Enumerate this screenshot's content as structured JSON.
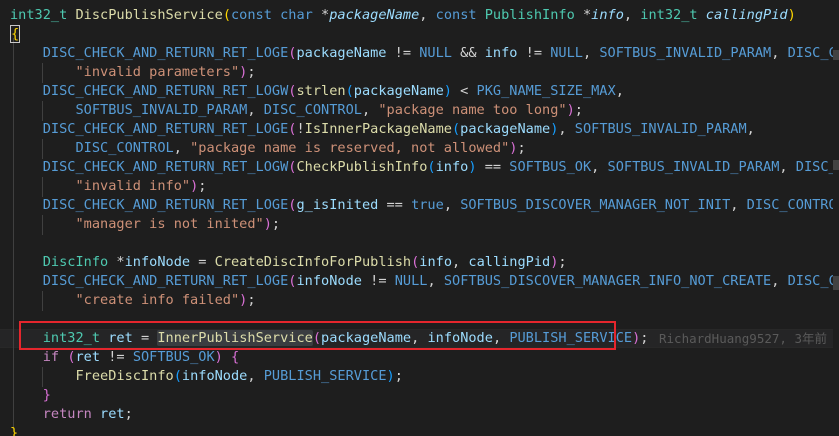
{
  "editor": {
    "blame": "RichardHuang9527, 3年前",
    "lines": [
      [
        [
          "int32_t",
          "type"
        ],
        [
          " ",
          "plain"
        ],
        [
          "DiscPublishService",
          "fn"
        ],
        [
          "(",
          "brace1"
        ],
        [
          "const",
          "kw"
        ],
        [
          " ",
          "plain"
        ],
        [
          "char",
          "kw"
        ],
        [
          " *",
          "plain"
        ],
        [
          "packageName",
          "param"
        ],
        [
          ", ",
          "plain"
        ],
        [
          "const",
          "kw"
        ],
        [
          " ",
          "plain"
        ],
        [
          "PublishInfo",
          "type"
        ],
        [
          " *",
          "plain"
        ],
        [
          "info",
          "param"
        ],
        [
          ", ",
          "plain"
        ],
        [
          "int32_t",
          "type"
        ],
        [
          " ",
          "plain"
        ],
        [
          "callingPid",
          "param"
        ],
        [
          ")",
          "brace1"
        ]
      ],
      [
        [
          "{",
          "brace1"
        ]
      ],
      [
        [
          "    ",
          "plain"
        ],
        [
          "DISC_CHECK_AND_RETURN_RET_LOGE",
          "macro"
        ],
        [
          "(",
          "brace2"
        ],
        [
          "packageName",
          "var"
        ],
        [
          " != ",
          "plain"
        ],
        [
          "NULL",
          "macro"
        ],
        [
          " && ",
          "plain"
        ],
        [
          "info",
          "var"
        ],
        [
          " != ",
          "plain"
        ],
        [
          "NULL",
          "macro"
        ],
        [
          ", ",
          "plain"
        ],
        [
          "SOFTBUS_INVALID_PARAM",
          "macro"
        ],
        [
          ", ",
          "plain"
        ],
        [
          "DISC_CONTROL",
          "macro"
        ],
        [
          ",",
          "plain"
        ]
      ],
      [
        [
          "        ",
          "plain"
        ],
        [
          "\"invalid parameters\"",
          "str"
        ],
        [
          ")",
          "brace2"
        ],
        [
          ";",
          "plain"
        ]
      ],
      [
        [
          "    ",
          "plain"
        ],
        [
          "DISC_CHECK_AND_RETURN_RET_LOGW",
          "macro"
        ],
        [
          "(",
          "brace2"
        ],
        [
          "strlen",
          "fn"
        ],
        [
          "(",
          "brace3"
        ],
        [
          "packageName",
          "var"
        ],
        [
          ")",
          "brace3"
        ],
        [
          " < ",
          "plain"
        ],
        [
          "PKG_NAME_SIZE_MAX",
          "macro"
        ],
        [
          ",",
          "plain"
        ]
      ],
      [
        [
          "        ",
          "plain"
        ],
        [
          "SOFTBUS_INVALID_PARAM",
          "macro"
        ],
        [
          ", ",
          "plain"
        ],
        [
          "DISC_CONTROL",
          "macro"
        ],
        [
          ", ",
          "plain"
        ],
        [
          "\"package name too long\"",
          "str"
        ],
        [
          ")",
          "brace2"
        ],
        [
          ";",
          "plain"
        ]
      ],
      [
        [
          "    ",
          "plain"
        ],
        [
          "DISC_CHECK_AND_RETURN_RET_LOGE",
          "macro"
        ],
        [
          "(",
          "brace2"
        ],
        [
          "!",
          "plain"
        ],
        [
          "IsInnerPackageName",
          "fn"
        ],
        [
          "(",
          "brace3"
        ],
        [
          "packageName",
          "var"
        ],
        [
          ")",
          "brace3"
        ],
        [
          ", ",
          "plain"
        ],
        [
          "SOFTBUS_INVALID_PARAM",
          "macro"
        ],
        [
          ",",
          "plain"
        ]
      ],
      [
        [
          "        ",
          "plain"
        ],
        [
          "DISC_CONTROL",
          "macro"
        ],
        [
          ", ",
          "plain"
        ],
        [
          "\"package name is reserved, not allowed\"",
          "str"
        ],
        [
          ")",
          "brace2"
        ],
        [
          ";",
          "plain"
        ]
      ],
      [
        [
          "    ",
          "plain"
        ],
        [
          "DISC_CHECK_AND_RETURN_RET_LOGW",
          "macro"
        ],
        [
          "(",
          "brace2"
        ],
        [
          "CheckPublishInfo",
          "fn"
        ],
        [
          "(",
          "brace3"
        ],
        [
          "info",
          "var"
        ],
        [
          ")",
          "brace3"
        ],
        [
          " == ",
          "plain"
        ],
        [
          "SOFTBUS_OK",
          "macro"
        ],
        [
          ", ",
          "plain"
        ],
        [
          "SOFTBUS_INVALID_PARAM",
          "macro"
        ],
        [
          ", ",
          "plain"
        ],
        [
          "DISC_CONTROL",
          "macro"
        ],
        [
          ",",
          "plain"
        ]
      ],
      [
        [
          "        ",
          "plain"
        ],
        [
          "\"invalid info\"",
          "str"
        ],
        [
          ")",
          "brace2"
        ],
        [
          ";",
          "plain"
        ]
      ],
      [
        [
          "    ",
          "plain"
        ],
        [
          "DISC_CHECK_AND_RETURN_RET_LOGE",
          "macro"
        ],
        [
          "(",
          "brace2"
        ],
        [
          "g_isInited",
          "var"
        ],
        [
          " == ",
          "plain"
        ],
        [
          "true",
          "kwlit"
        ],
        [
          ", ",
          "plain"
        ],
        [
          "SOFTBUS_DISCOVER_MANAGER_NOT_INIT",
          "macro"
        ],
        [
          ", ",
          "plain"
        ],
        [
          "DISC_CONTROL",
          "macro"
        ],
        [
          ",",
          "plain"
        ]
      ],
      [
        [
          "        ",
          "plain"
        ],
        [
          "\"manager is not inited\"",
          "str"
        ],
        [
          ")",
          "brace2"
        ],
        [
          ";",
          "plain"
        ]
      ],
      [],
      [
        [
          "    ",
          "plain"
        ],
        [
          "DiscInfo",
          "type"
        ],
        [
          " *",
          "plain"
        ],
        [
          "infoNode",
          "var"
        ],
        [
          " = ",
          "plain"
        ],
        [
          "CreateDiscInfoForPublish",
          "fn"
        ],
        [
          "(",
          "brace2"
        ],
        [
          "info",
          "var"
        ],
        [
          ", ",
          "plain"
        ],
        [
          "callingPid",
          "var"
        ],
        [
          ")",
          "brace2"
        ],
        [
          ";",
          "plain"
        ]
      ],
      [
        [
          "    ",
          "plain"
        ],
        [
          "DISC_CHECK_AND_RETURN_RET_LOGE",
          "macro"
        ],
        [
          "(",
          "brace2"
        ],
        [
          "infoNode",
          "var"
        ],
        [
          " != ",
          "plain"
        ],
        [
          "NULL",
          "macro"
        ],
        [
          ", ",
          "plain"
        ],
        [
          "SOFTBUS_DISCOVER_MANAGER_INFO_NOT_CREATE",
          "macro"
        ],
        [
          ", ",
          "plain"
        ],
        [
          "DISC_CONTROL",
          "macro"
        ],
        [
          ",",
          "plain"
        ]
      ],
      [
        [
          "        ",
          "plain"
        ],
        [
          "\"create info failed\"",
          "str"
        ],
        [
          ")",
          "brace2"
        ],
        [
          ";",
          "plain"
        ]
      ],
      [],
      [
        [
          "    ",
          "plain"
        ],
        [
          "int32_t",
          "type"
        ],
        [
          " ",
          "plain"
        ],
        [
          "ret",
          "var"
        ],
        [
          " = ",
          "plain"
        ],
        [
          "InnerPublishService",
          "fn-hl"
        ],
        [
          "(",
          "brace2"
        ],
        [
          "packageName",
          "var"
        ],
        [
          ", ",
          "plain"
        ],
        [
          "infoNode",
          "var"
        ],
        [
          ", ",
          "plain"
        ],
        [
          "PUBLISH_SERVICE",
          "macro"
        ],
        [
          ")",
          "brace2"
        ],
        [
          ";",
          "plain"
        ]
      ],
      [
        [
          "    ",
          "plain"
        ],
        [
          "if",
          "ctrl"
        ],
        [
          " ",
          "plain"
        ],
        [
          "(",
          "brace2"
        ],
        [
          "ret",
          "var"
        ],
        [
          " != ",
          "plain"
        ],
        [
          "SOFTBUS_OK",
          "macro"
        ],
        [
          ")",
          "brace2"
        ],
        [
          " ",
          "plain"
        ],
        [
          "{",
          "brace2"
        ]
      ],
      [
        [
          "        ",
          "plain"
        ],
        [
          "FreeDiscInfo",
          "fn"
        ],
        [
          "(",
          "brace3"
        ],
        [
          "infoNode",
          "var"
        ],
        [
          ", ",
          "plain"
        ],
        [
          "PUBLISH_SERVICE",
          "macro"
        ],
        [
          ")",
          "brace3"
        ],
        [
          ";",
          "plain"
        ]
      ],
      [
        [
          "    ",
          "plain"
        ],
        [
          "}",
          "brace2"
        ]
      ],
      [
        [
          "    ",
          "plain"
        ],
        [
          "return",
          "ctrl"
        ],
        [
          " ",
          "plain"
        ],
        [
          "ret",
          "var"
        ],
        [
          ";",
          "plain"
        ]
      ],
      [
        [
          "}",
          "brace1"
        ]
      ]
    ]
  }
}
